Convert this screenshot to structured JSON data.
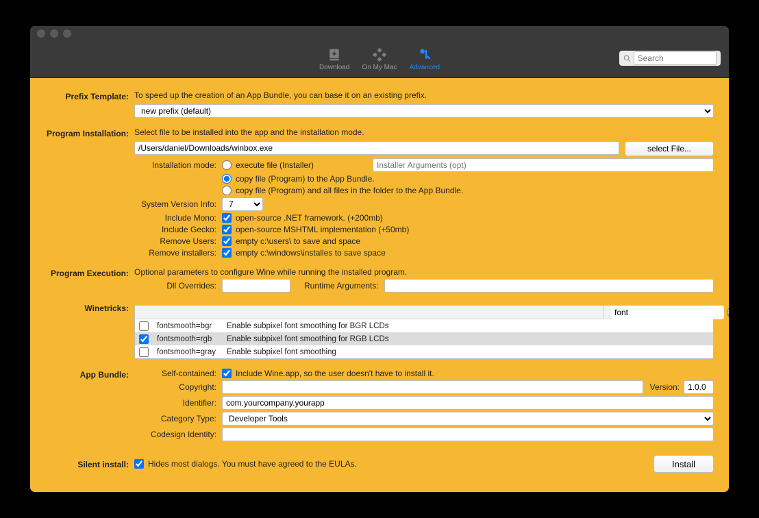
{
  "toolbar": {
    "tabs": {
      "download": "Download",
      "onmymac": "On My Mac",
      "advanced": "Advanced"
    },
    "search_placeholder": "Search"
  },
  "prefix": {
    "section": "Prefix Template:",
    "desc": "To speed up the creation of an App Bundle, you can base it on an existing prefix.",
    "select_value": "new prefix (default)"
  },
  "install": {
    "section": "Program Installation:",
    "desc": "Select file to be installed into the app and the installation mode.",
    "path": "/Users/daniel/Downloads/winbox.exe",
    "select_file_btn": "select File...",
    "mode_label": "Installation mode:",
    "mode_execute": "execute file (Installer)",
    "installer_args_placeholder": "Installer Arguments (opt)",
    "mode_copy1": "copy file (Program)  to the App Bundle.",
    "mode_copy2": "copy file (Program)  and all files in the folder to the App Bundle.",
    "sys_ver_label": "System Version Info:",
    "sys_ver_value": "7",
    "mono_label": "Include Mono:",
    "mono_desc": "open-source .NET framework. (+200mb)",
    "gecko_label": "Include Gecko:",
    "gecko_desc": "open-source MSHTML implementation (+50mb)",
    "remove_users_label": "Remove Users:",
    "remove_users_desc": "empty c:\\users\\ to save and space",
    "remove_installers_label": "Remove installers:",
    "remove_installers_desc": "empty c:\\windows\\installes to save space"
  },
  "exec": {
    "section": "Program Execution:",
    "desc": "Optional parameters to configure Wine while running the installed program.",
    "dll_label": "Dll Overrides:",
    "runtime_label": "Runtime Arguments:"
  },
  "winetricks": {
    "section": "Winetricks:",
    "search_value": "font",
    "rows": [
      {
        "checked": false,
        "name": "fontsmooth=bgr",
        "desc": "Enable subpixel font smoothing for BGR LCDs"
      },
      {
        "checked": true,
        "name": "fontsmooth=rgb",
        "desc": "Enable subpixel font smoothing for RGB LCDs"
      },
      {
        "checked": false,
        "name": "fontsmooth=gray",
        "desc": "Enable subpixel font smoothing"
      }
    ]
  },
  "bundle": {
    "section": "App Bundle:",
    "self_label": "Self-contained:",
    "self_desc": "Include Wine.app, so the user doesn't have to install it.",
    "copyright_label": "Copyright:",
    "version_label": "Version:",
    "version_value": "1.0.0",
    "identifier_label": "Identifier:",
    "identifier_value": "com.yourcompany.yourapp",
    "category_label": "Category Type:",
    "category_value": "Developer Tools",
    "codesign_label": "Codesign Identity:"
  },
  "silent": {
    "section": "Silent install:",
    "desc": "Hides most dialogs. You must have agreed to the EULAs."
  },
  "install_btn": "Install"
}
